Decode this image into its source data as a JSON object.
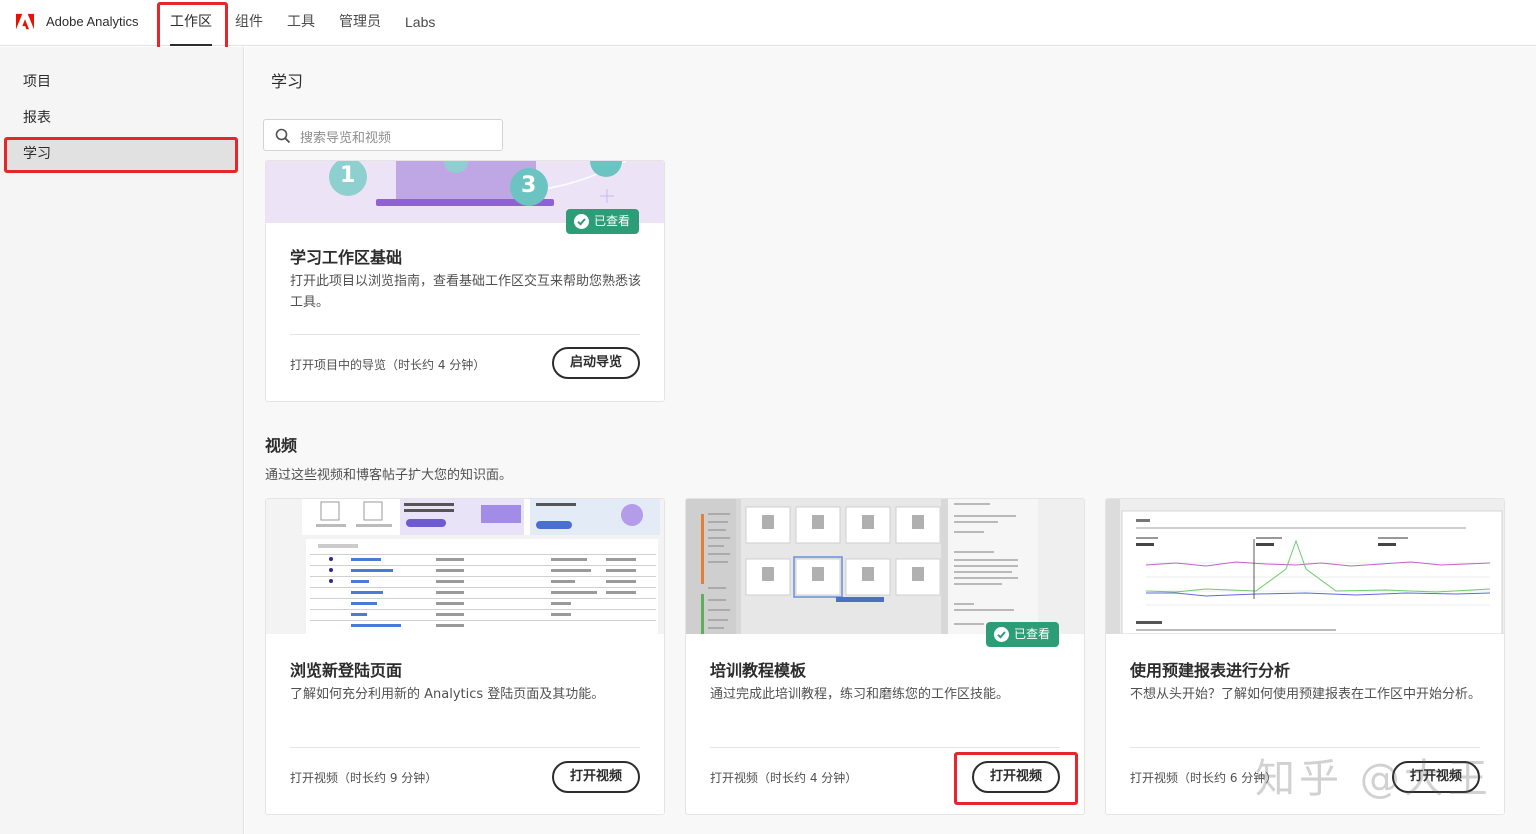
{
  "app": {
    "brand": "Adobe Analytics",
    "accent": "#eb1000"
  },
  "topnav": [
    {
      "label": "工作区",
      "active": true
    },
    {
      "label": "组件"
    },
    {
      "label": "工具"
    },
    {
      "label": "管理员"
    },
    {
      "label": "Labs"
    }
  ],
  "sidebar": {
    "items": [
      {
        "label": "项目"
      },
      {
        "label": "报表"
      },
      {
        "label": "学习",
        "active": true
      }
    ]
  },
  "page": {
    "title": "学习"
  },
  "search": {
    "placeholder": "搜索导览和视频"
  },
  "tour_card": {
    "step1": "1",
    "step3": "3",
    "badge": "已查看",
    "title": "学习工作区基础",
    "desc": "打开此项目以浏览指南，查看基础工作区交互来帮助您熟悉该工具。",
    "meta": "打开项目中的导览（时长约 4 分钟）",
    "button": "启动导览"
  },
  "videos": {
    "title": "视频",
    "desc": "通过这些视频和博客帖子扩大您的知识面。",
    "cards": [
      {
        "title": "浏览新登陆页面",
        "desc": "了解如何充分利用新的 Analytics 登陆页面及其功能。",
        "meta": "打开视频（时长约 9 分钟）",
        "button": "打开视频"
      },
      {
        "title": "培训教程模板",
        "desc": "通过完成此培训教程，练习和磨练您的工作区技能。",
        "meta": "打开视频（时长约 4 分钟）",
        "button": "打开视频",
        "badge": "已查看"
      },
      {
        "title": "使用预建报表进行分析",
        "desc": "不想从头开始？了解如何使用预建报表在工作区中开始分析。",
        "meta": "打开视频（时长约 6 分钟）",
        "button": "打开视频"
      }
    ]
  },
  "watermark": "知乎 @大王",
  "colors": {
    "highlight": "#e6262b",
    "badge": "#2d9d78"
  }
}
